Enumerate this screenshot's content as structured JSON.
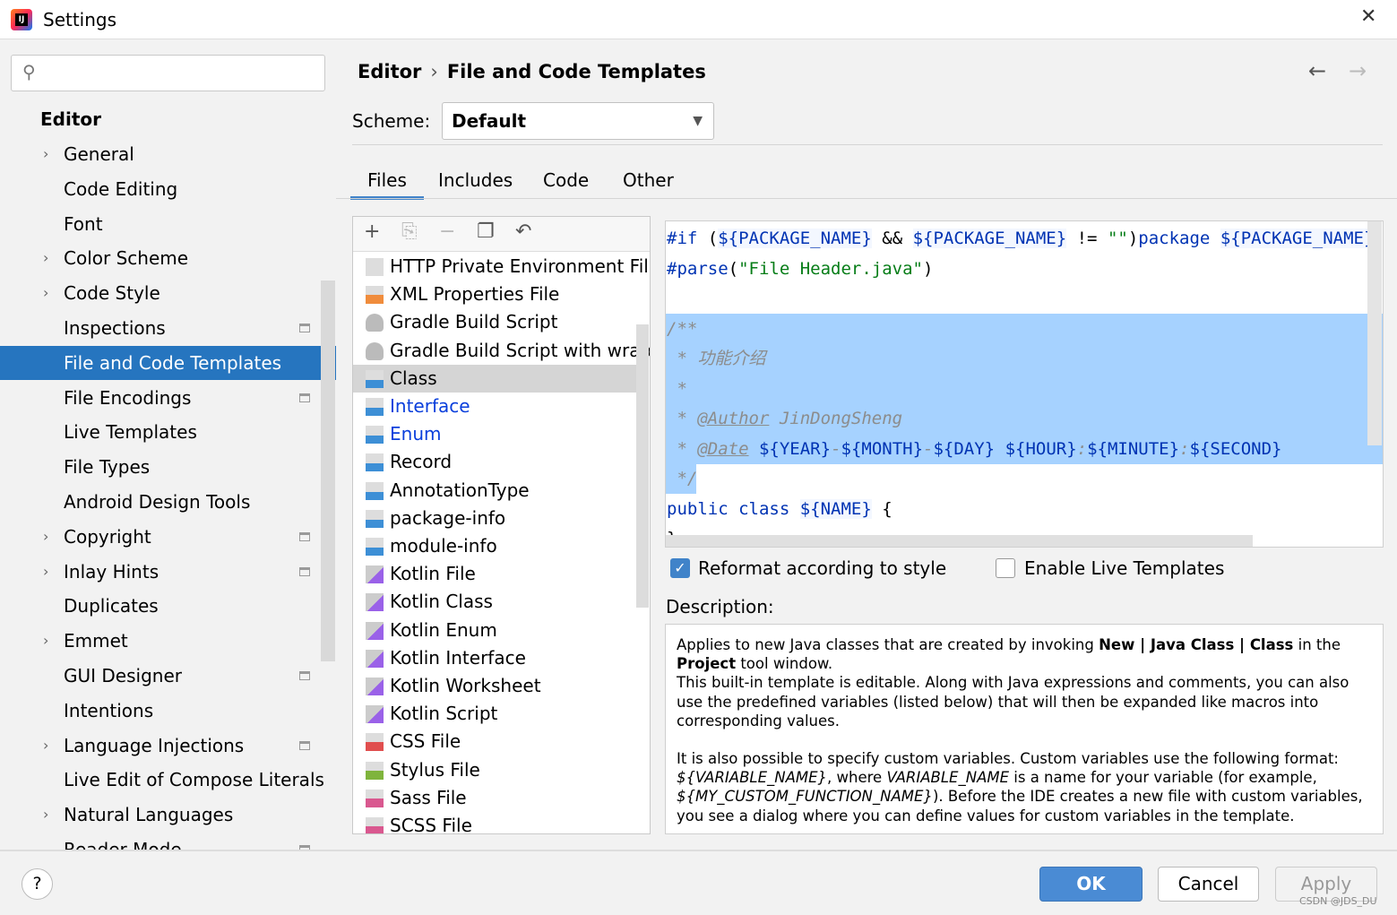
{
  "window": {
    "title": "Settings",
    "close_icon": "close-icon",
    "app_icon": "intellij-idea-icon",
    "app_icon_letters": "IJ"
  },
  "sidebar": {
    "search": {
      "value": "",
      "placeholder": ""
    },
    "section": "Editor",
    "items": [
      {
        "label": "General",
        "expandable": true,
        "project_level": false
      },
      {
        "label": "Code Editing",
        "expandable": false,
        "project_level": false
      },
      {
        "label": "Font",
        "expandable": false,
        "project_level": false
      },
      {
        "label": "Color Scheme",
        "expandable": true,
        "project_level": false
      },
      {
        "label": "Code Style",
        "expandable": true,
        "project_level": false
      },
      {
        "label": "Inspections",
        "expandable": false,
        "project_level": true
      },
      {
        "label": "File and Code Templates",
        "expandable": false,
        "project_level": false,
        "selected": true
      },
      {
        "label": "File Encodings",
        "expandable": false,
        "project_level": true
      },
      {
        "label": "Live Templates",
        "expandable": false,
        "project_level": false
      },
      {
        "label": "File Types",
        "expandable": false,
        "project_level": false
      },
      {
        "label": "Android Design Tools",
        "expandable": false,
        "project_level": false
      },
      {
        "label": "Copyright",
        "expandable": true,
        "project_level": true
      },
      {
        "label": "Inlay Hints",
        "expandable": true,
        "project_level": true
      },
      {
        "label": "Duplicates",
        "expandable": false,
        "project_level": false
      },
      {
        "label": "Emmet",
        "expandable": true,
        "project_level": false
      },
      {
        "label": "GUI Designer",
        "expandable": false,
        "project_level": true
      },
      {
        "label": "Intentions",
        "expandable": false,
        "project_level": false
      },
      {
        "label": "Language Injections",
        "expandable": true,
        "project_level": true
      },
      {
        "label": "Live Edit of Compose Literals",
        "expandable": false,
        "project_level": false
      },
      {
        "label": "Natural Languages",
        "expandable": true,
        "project_level": false
      },
      {
        "label": "Reader Mode",
        "expandable": false,
        "project_level": true
      }
    ]
  },
  "header": {
    "breadcrumb": [
      "Editor",
      "File and Code Templates"
    ],
    "back_icon": "arrow-left-icon",
    "forward_icon": "arrow-right-icon"
  },
  "scheme": {
    "label": "Scheme:",
    "value": "Default"
  },
  "tabs": [
    {
      "label": "Files",
      "selected": true
    },
    {
      "label": "Includes"
    },
    {
      "label": "Code"
    },
    {
      "label": "Other"
    }
  ],
  "toolbar": [
    "add-icon",
    "copy-template-icon",
    "remove-icon",
    "duplicate-icon",
    "reset-icon"
  ],
  "templates": [
    {
      "label": "HTTP Private Environment File",
      "icon": "json-file-icon"
    },
    {
      "label": "XML Properties File",
      "icon": "xml-file-icon"
    },
    {
      "label": "Gradle Build Script",
      "icon": "gradle-icon"
    },
    {
      "label": "Gradle Build Script with wrapper",
      "icon": "gradle-icon"
    },
    {
      "label": "Class",
      "icon": "java-file-icon",
      "selected": true
    },
    {
      "label": "Interface",
      "icon": "java-file-icon",
      "modified": true
    },
    {
      "label": "Enum",
      "icon": "java-file-icon",
      "modified": true
    },
    {
      "label": "Record",
      "icon": "java-file-icon"
    },
    {
      "label": "AnnotationType",
      "icon": "java-file-icon"
    },
    {
      "label": "package-info",
      "icon": "java-file-icon"
    },
    {
      "label": "module-info",
      "icon": "java-file-icon"
    },
    {
      "label": "Kotlin File",
      "icon": "kotlin-file-icon"
    },
    {
      "label": "Kotlin Class",
      "icon": "kotlin-file-icon"
    },
    {
      "label": "Kotlin Enum",
      "icon": "kotlin-file-icon"
    },
    {
      "label": "Kotlin Interface",
      "icon": "kotlin-file-icon"
    },
    {
      "label": "Kotlin Worksheet",
      "icon": "kotlin-file-icon"
    },
    {
      "label": "Kotlin Script",
      "icon": "kotlin-file-icon"
    },
    {
      "label": "CSS File",
      "icon": "css-file-icon"
    },
    {
      "label": "Stylus File",
      "icon": "stylus-file-icon"
    },
    {
      "label": "Sass File",
      "icon": "sass-file-icon"
    },
    {
      "label": "SCSS File",
      "icon": "scss-file-icon"
    }
  ],
  "editor": {
    "lines": [
      "#if (${PACKAGE_NAME} && ${PACKAGE_NAME} != \"\")package ${PACKAGE_NAME};#end",
      "#parse(\"File Header.java\")",
      "",
      "/**",
      " * 功能介绍",
      " *",
      " * @Author JinDongSheng",
      " * @Date ${YEAR}-${MONTH}-${DAY} ${HOUR}:${MINUTE}:${SECOND}",
      " */",
      "public class ${NAME} {",
      "}"
    ]
  },
  "options": {
    "reformat": {
      "label": "Reformat according to style",
      "checked": true
    },
    "live_templates": {
      "label": "Enable Live Templates",
      "checked": false
    }
  },
  "description": {
    "label": "Description:",
    "p1_a": "Applies to new Java classes that are created by invoking ",
    "p1_b": "New | Java Class | Class",
    "p1_c": " in the ",
    "p1_d": "Project",
    "p1_e": " tool window.",
    "p1_f": "This built-in template is editable. Along with Java expressions and comments, you can also use the predefined variables (listed below) that will then be expanded like macros into corresponding values.",
    "p2_a": "It is also possible to specify custom variables. Custom variables use the following format: ",
    "p2_b": "${VARIABLE_NAME}",
    "p2_c": ", where ",
    "p2_d": "VARIABLE_NAME",
    "p2_e": " is a name for your variable (for example, ",
    "p2_f": "${MY_CUSTOM_FUNCTION_NAME}",
    "p2_g": "). Before the IDE creates a new file with custom variables, you see a dialog where you can define values for custom variables in the template."
  },
  "footer": {
    "help": "?",
    "ok": "OK",
    "cancel": "Cancel",
    "apply": "Apply",
    "watermark": "CSDN @JDS_DU"
  },
  "colors": {
    "selection": "#2675bf",
    "ok_button": "#4a8bd4",
    "modified_template": "#0a3fdc",
    "editor_selection": "#a6d2ff"
  }
}
